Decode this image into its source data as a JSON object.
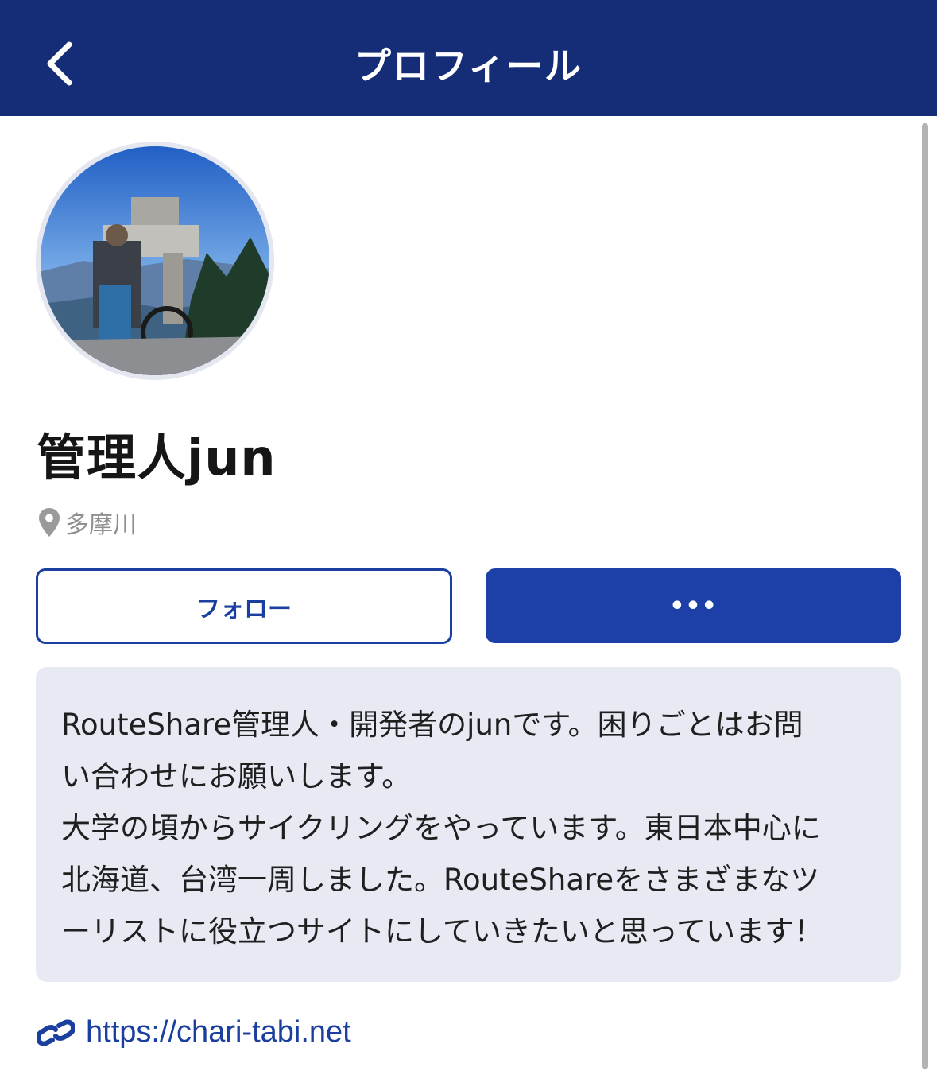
{
  "header": {
    "title": "プロフィール",
    "back_icon": "chevron-left-icon"
  },
  "profile": {
    "name": "管理人jun",
    "location": "多摩川",
    "location_icon": "map-pin-icon",
    "avatar": "profile-photo"
  },
  "actions": {
    "follow_label": "フォロー",
    "more_label": "•••"
  },
  "bio": {
    "text": "RouteShare管理人・開発者のjunです。困りごとはお問\nい合わせにお願いします。\n大学の頃からサイクリングをやっています。東日本中心に\n北海道、台湾一周しました。RouteShareをさまざまなツ\nーリストに役立つサイトにしていきたいと思っています！"
  },
  "website": {
    "url": "https://chari-tabi.net",
    "icon": "link-icon"
  },
  "colors": {
    "header_bg": "#152c77",
    "primary": "#1c40a8",
    "bio_bg": "#e7eaf3",
    "muted": "#8f8f8f"
  }
}
